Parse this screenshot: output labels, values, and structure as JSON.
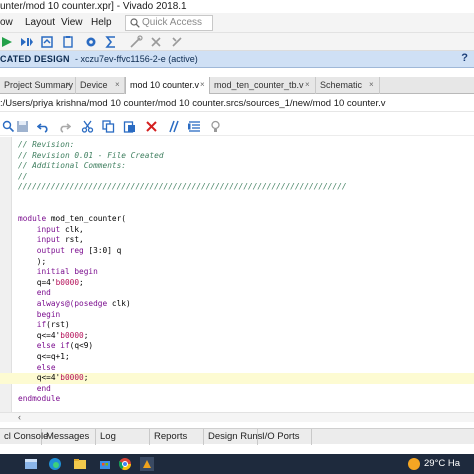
{
  "window": {
    "title": "unter/mod 10 counter.xpr] - Vivado 2018.1"
  },
  "menubar": {
    "items": [
      "ow",
      "Layout",
      "View",
      "Help"
    ],
    "quick_access_placeholder": "Quick Access"
  },
  "design_bar": {
    "title": "CATED DESIGN",
    "part": "- xczu7ev-ffvc1156-2-e  (active)",
    "help": "?"
  },
  "tabs": [
    {
      "label": "Project Summary",
      "active": false
    },
    {
      "label": "Device",
      "active": false
    },
    {
      "label": "mod 10 counter.v",
      "active": true
    },
    {
      "label": "mod_ten_counter_tb.v",
      "active": false
    },
    {
      "label": "Schematic",
      "active": false
    }
  ],
  "tab_close_glyph": "×",
  "file_path": ":/Users/priya krishna/mod 10 counter/mod 10 counter.srcs/sources_1/new/mod 10 counter.v",
  "code": [
    {
      "gutter": "",
      "parts": [
        {
          "cls": "c",
          "text": "// Revision:"
        }
      ]
    },
    {
      "gutter": "",
      "parts": [
        {
          "cls": "c",
          "text": "// Revision 0.01 - File Created"
        }
      ]
    },
    {
      "gutter": "",
      "parts": [
        {
          "cls": "c",
          "text": "// Additional Comments:"
        }
      ]
    },
    {
      "gutter": "",
      "parts": [
        {
          "cls": "c",
          "text": "//"
        }
      ]
    },
    {
      "gutter": "",
      "parts": [
        {
          "cls": "c",
          "text": "//////////////////////////////////////////////////////////////////////"
        }
      ]
    },
    {
      "gutter": "",
      "parts": []
    },
    {
      "gutter": "",
      "parts": []
    },
    {
      "gutter": "",
      "parts": [
        {
          "cls": "k",
          "text": "module"
        },
        {
          "cls": "t",
          "text": " mod_ten_counter("
        }
      ]
    },
    {
      "gutter": "",
      "parts": [
        {
          "cls": "t",
          "text": "    "
        },
        {
          "cls": "k",
          "text": "input"
        },
        {
          "cls": "t",
          "text": " clk,"
        }
      ]
    },
    {
      "gutter": "",
      "parts": [
        {
          "cls": "t",
          "text": "    "
        },
        {
          "cls": "k",
          "text": "input"
        },
        {
          "cls": "t",
          "text": " rst,"
        }
      ]
    },
    {
      "gutter": "",
      "parts": [
        {
          "cls": "t",
          "text": "    "
        },
        {
          "cls": "k",
          "text": "output reg"
        },
        {
          "cls": "t",
          "text": " [3:0] q"
        }
      ]
    },
    {
      "gutter": "",
      "parts": [
        {
          "cls": "t",
          "text": "    );"
        }
      ]
    },
    {
      "gutter": "",
      "parts": [
        {
          "cls": "t",
          "text": "    "
        },
        {
          "cls": "k",
          "text": "initial begin"
        }
      ]
    },
    {
      "gutter": "",
      "parts": [
        {
          "cls": "t",
          "text": "    q=4'"
        },
        {
          "cls": "n",
          "text": "b0000"
        },
        {
          "cls": "t",
          "text": ";"
        }
      ]
    },
    {
      "gutter": "",
      "parts": [
        {
          "cls": "t",
          "text": "    "
        },
        {
          "cls": "k",
          "text": "end"
        }
      ]
    },
    {
      "gutter": "",
      "parts": [
        {
          "cls": "t",
          "text": "    "
        },
        {
          "cls": "k",
          "text": "always@(posedge"
        },
        {
          "cls": "t",
          "text": " clk)"
        }
      ]
    },
    {
      "gutter": "",
      "parts": [
        {
          "cls": "t",
          "text": "    "
        },
        {
          "cls": "k",
          "text": "begin"
        }
      ]
    },
    {
      "gutter": "",
      "parts": [
        {
          "cls": "t",
          "text": "    "
        },
        {
          "cls": "k",
          "text": "if"
        },
        {
          "cls": "t",
          "text": "(rst)"
        }
      ]
    },
    {
      "gutter": "",
      "parts": [
        {
          "cls": "t",
          "text": "    q<=4'"
        },
        {
          "cls": "n",
          "text": "b0000"
        },
        {
          "cls": "t",
          "text": ";"
        }
      ]
    },
    {
      "gutter": "",
      "parts": [
        {
          "cls": "t",
          "text": "    "
        },
        {
          "cls": "k",
          "text": "else if"
        },
        {
          "cls": "t",
          "text": "(q<9)"
        }
      ]
    },
    {
      "gutter": "",
      "parts": [
        {
          "cls": "t",
          "text": "    q<=q+1;"
        }
      ]
    },
    {
      "gutter": "",
      "parts": [
        {
          "cls": "t",
          "text": "    "
        },
        {
          "cls": "k",
          "text": "else"
        }
      ]
    },
    {
      "gutter": "",
      "parts": [
        {
          "cls": "t",
          "text": "    q<=4'"
        },
        {
          "cls": "n",
          "text": "b0000"
        },
        {
          "cls": "t",
          "text": ";"
        }
      ],
      "highlight": true
    },
    {
      "gutter": "",
      "parts": [
        {
          "cls": "t",
          "text": "    "
        },
        {
          "cls": "k",
          "text": "end"
        }
      ]
    },
    {
      "gutter": "",
      "parts": [
        {
          "cls": "k",
          "text": "endmodule"
        }
      ]
    }
  ],
  "bottom_tabs": [
    "cl Console",
    "Messages",
    "Log",
    "Reports",
    "Design Runs",
    "I/O Ports"
  ],
  "taskbar": {
    "temperature": "29°C  Ha"
  },
  "colors": {
    "design_bar": "#cfe0f5",
    "comment": "#3f7f5f",
    "keyword": "#7b0e8f",
    "number": "#b5115a",
    "highlight_line": "#fdfbd2",
    "taskbar": "#1e2a3d"
  }
}
